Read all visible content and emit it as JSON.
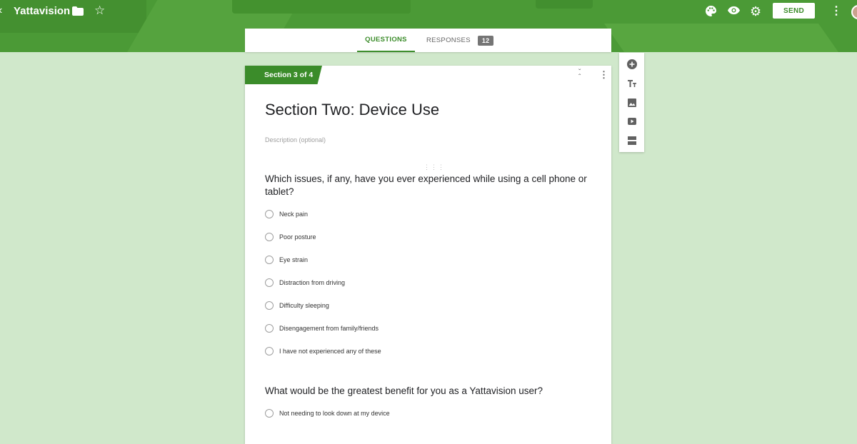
{
  "header": {
    "app_title": "Yattavision",
    "send_label": "SEND",
    "icons": [
      "back-arrow-icon",
      "folder-icon",
      "star-icon",
      "palette-icon",
      "eye-icon",
      "gear-icon",
      "more-vert-icon"
    ]
  },
  "tabs": {
    "questions_label": "QUESTIONS",
    "responses_label": "RESPONSES",
    "responses_count": "12"
  },
  "section": {
    "tag": "Section 3 of 4",
    "title": "Section Two: Device Use",
    "description_placeholder": "Description (optional)"
  },
  "questions": [
    {
      "text": "Which issues, if any, have you ever experienced while using a cell phone or tablet?",
      "options": [
        "Neck pain",
        "Poor posture",
        "Eye strain",
        "Distraction from driving",
        "Difficulty sleeping",
        "Disengagement from family/friends",
        "I have not experienced any of these"
      ]
    },
    {
      "text": "What would be the greatest benefit for you as a Yattavision user?",
      "options": [
        "Not needing to look down at my device"
      ]
    }
  ],
  "colors": {
    "brand_green": "#4b9a36",
    "accent_green": "#3b8c2a",
    "background": "#d0e8cb"
  }
}
